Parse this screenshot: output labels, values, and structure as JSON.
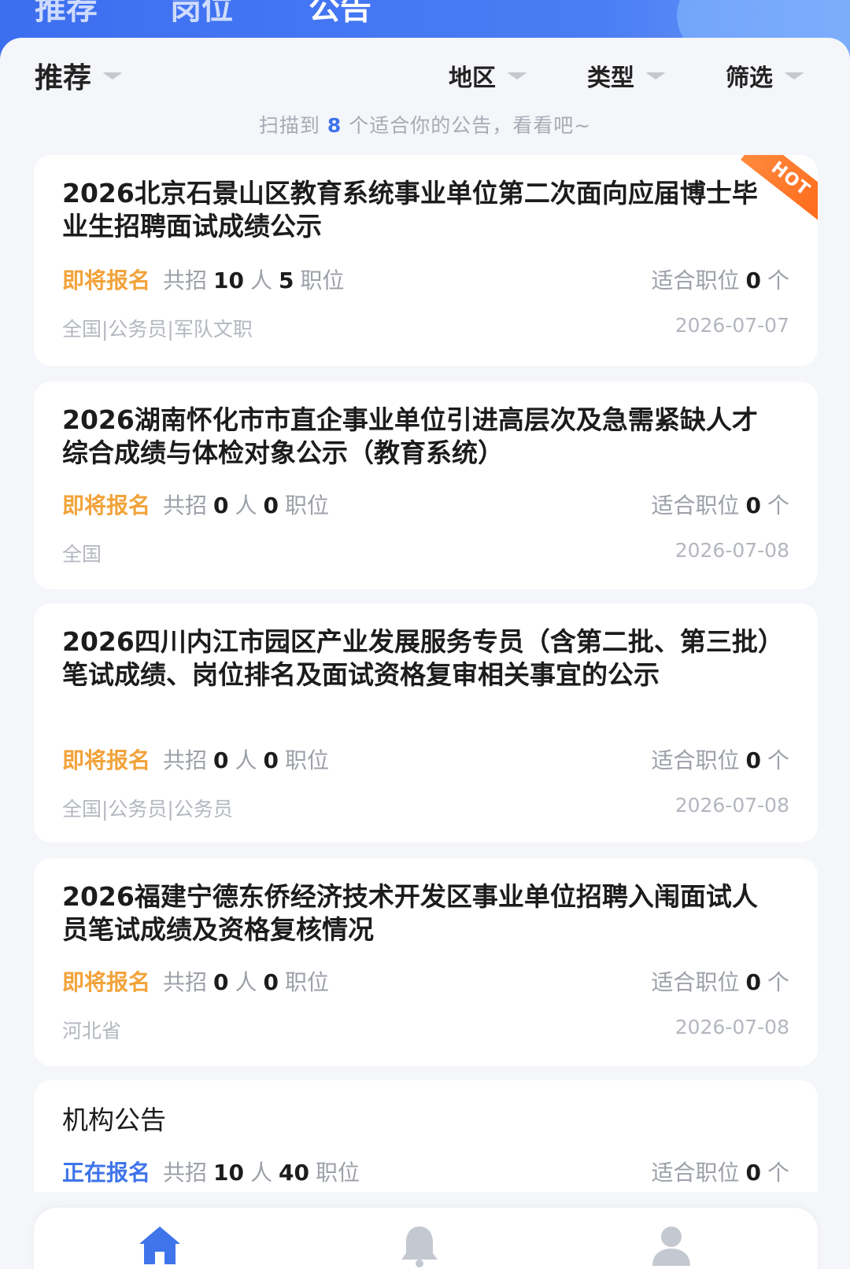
{
  "top_tabs": [
    "推荐",
    "岗位",
    "公告"
  ],
  "filters": {
    "recommend": "推荐",
    "region": "地区",
    "type": "类型",
    "screen": "筛选"
  },
  "scan_tip": {
    "prefix": "扫描到",
    "count": "8",
    "suffix": "个适合你的公告，看看吧~"
  },
  "cards": [
    {
      "title": "2026北京石景山区教育系统事业单位第二次面向应届博士毕业生招聘面试成绩公示",
      "status": "即将报名",
      "recruit_prefix": "共招",
      "people": "10",
      "people_unit": "人",
      "positions": "5",
      "positions_unit": "职位",
      "match_prefix": "适合职位",
      "match": "0",
      "match_unit": "个",
      "tags": "全国|公务员|军队文职",
      "date": "2026-07-07",
      "hot": "HOT"
    },
    {
      "title": "2026湖南怀化市市直企事业单位引进高层次及急需紧缺人才综合成绩与体检对象公示（教育系统）",
      "status": "即将报名",
      "recruit_prefix": "共招",
      "people": "0",
      "people_unit": "人",
      "positions": "0",
      "positions_unit": "职位",
      "match_prefix": "适合职位",
      "match": "0",
      "match_unit": "个",
      "tags": "全国",
      "date": "2026-07-08"
    },
    {
      "title": "2026四川内江市园区产业发展服务专员（含第二批、第三批）笔试成绩、岗位排名及面试资格复审相关事宜的公示",
      "status": "即将报名",
      "recruit_prefix": "共招",
      "people": "0",
      "people_unit": "人",
      "positions": "0",
      "positions_unit": "职位",
      "match_prefix": "适合职位",
      "match": "0",
      "match_unit": "个",
      "tags": "全国|公务员|公务员",
      "date": "2026-07-08"
    },
    {
      "title": "2026福建宁德东侨经济技术开发区事业单位招聘入闱面试人员笔试成绩及资格复核情况",
      "status": "即将报名",
      "recruit_prefix": "共招",
      "people": "0",
      "people_unit": "人",
      "positions": "0",
      "positions_unit": "职位",
      "match_prefix": "适合职位",
      "match": "0",
      "match_unit": "个",
      "tags": "河北省",
      "date": "2026-07-08"
    },
    {
      "title": "机构公告",
      "status": "正在报名",
      "recruit_prefix": "共招",
      "people": "10",
      "people_unit": "人",
      "positions": "40",
      "positions_unit": "职位",
      "match_prefix": "适合职位",
      "match": "0",
      "match_unit": "个"
    }
  ],
  "tabbar": {
    "home": "首页",
    "message": "消息",
    "mine": "我的",
    "active_color": "#3f74ea"
  }
}
